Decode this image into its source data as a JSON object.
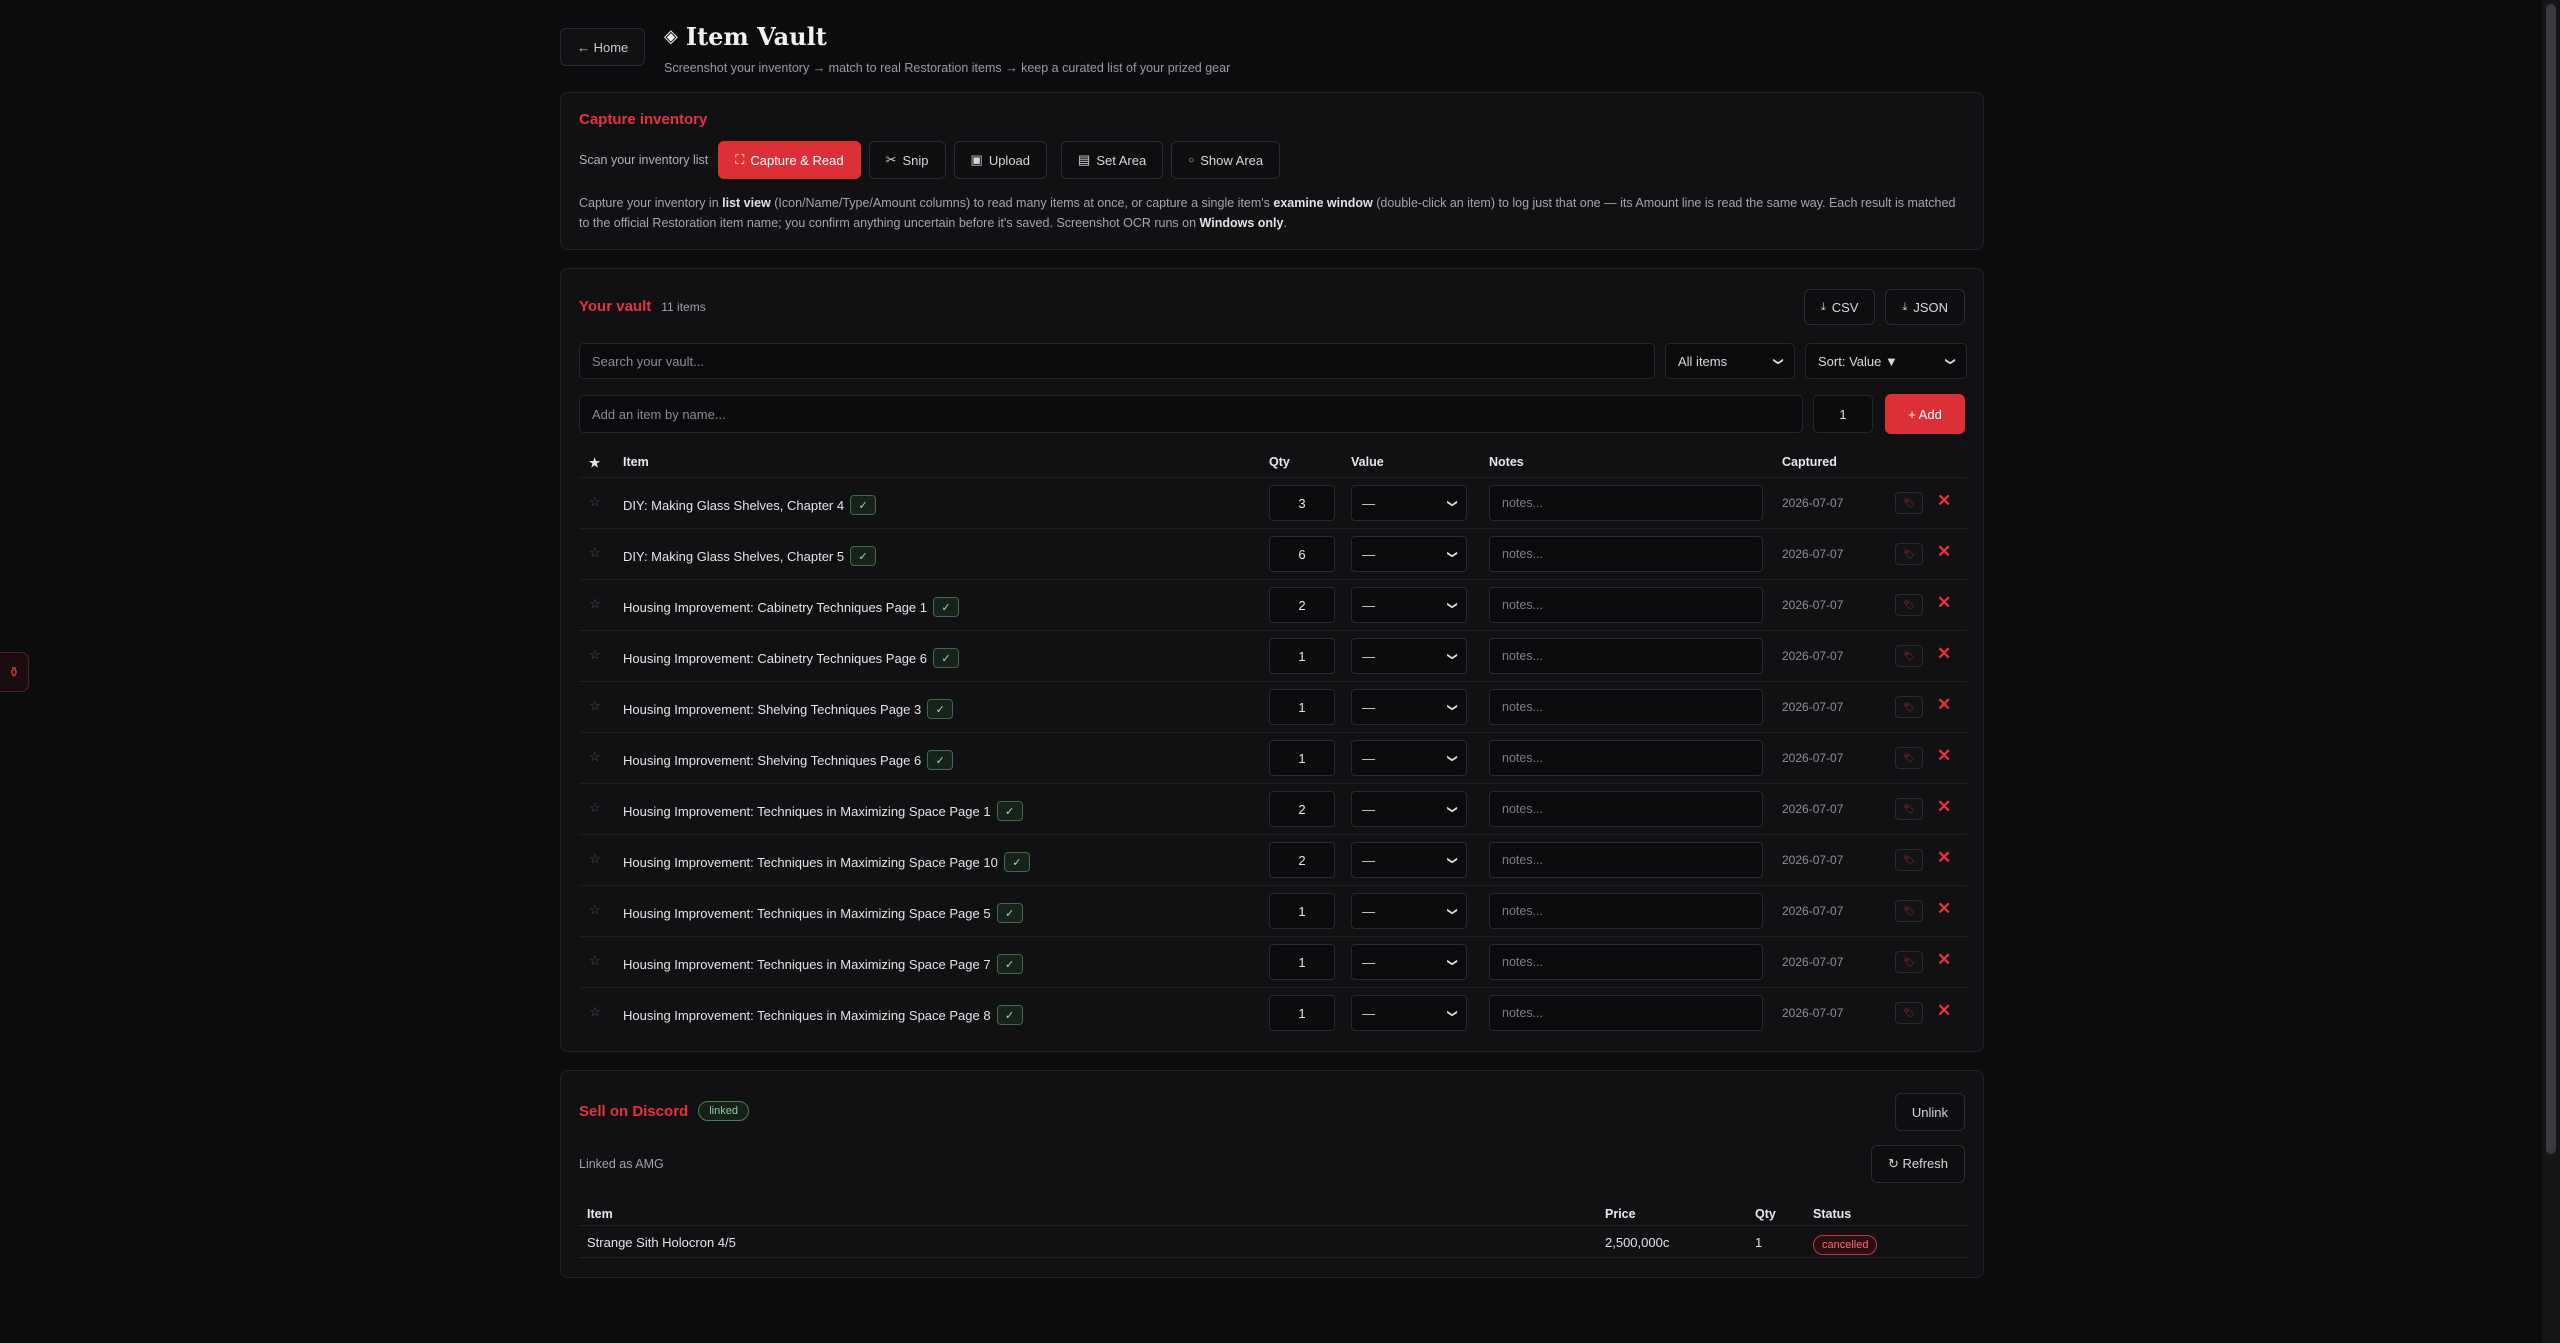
{
  "header": {
    "home_label": "← Home",
    "title": "Item Vault",
    "subtitle": "Screenshot your inventory → match to real Restoration items → keep a curated list of your prized gear"
  },
  "capture": {
    "title": "Capture inventory",
    "scan_label": "Scan your inventory list",
    "buttons": {
      "capture": "Capture & Read",
      "snip": "Snip",
      "upload": "Upload",
      "set_area": "Set Area",
      "show_area": "Show Area"
    },
    "desc": {
      "p1": "Capture your inventory in ",
      "b1": "list view",
      "p2": " (Icon/Name/Type/Amount columns) to read many items at once, or capture a single item's ",
      "b2": "examine window",
      "p3": " (double-click an item) to log just that one — its Amount line is read the same way. Each result is matched to the official Restoration item name; you confirm anything uncertain before it's saved. Screenshot OCR runs on ",
      "b3": "Windows only",
      "p4": "."
    }
  },
  "vault": {
    "title": "Your vault",
    "count": "11 items",
    "export_csv": "CSV",
    "export_json": "JSON",
    "search_placeholder": "Search your vault...",
    "filter_selected": "All items",
    "sort_selected": "Sort: Value ▼",
    "add_placeholder": "Add an item by name...",
    "add_qty": "1",
    "add_label": "+ Add",
    "columns": {
      "star": "★",
      "item": "Item",
      "qty": "Qty",
      "value": "Value",
      "notes": "Notes",
      "captured": "Captured"
    },
    "rows": [
      {
        "name": "DIY: Making Glass Shelves, Chapter 4",
        "qty": "3",
        "value": "—",
        "notes": "notes...",
        "captured": "2026-07-07"
      },
      {
        "name": "DIY: Making Glass Shelves, Chapter 5",
        "qty": "6",
        "value": "—",
        "notes": "notes...",
        "captured": "2026-07-07"
      },
      {
        "name": "Housing Improvement: Cabinetry Techniques Page 1",
        "qty": "2",
        "value": "—",
        "notes": "notes...",
        "captured": "2026-07-07"
      },
      {
        "name": "Housing Improvement: Cabinetry Techniques Page 6",
        "qty": "1",
        "value": "—",
        "notes": "notes...",
        "captured": "2026-07-07"
      },
      {
        "name": "Housing Improvement: Shelving Techniques Page 3",
        "qty": "1",
        "value": "—",
        "notes": "notes...",
        "captured": "2026-07-07"
      },
      {
        "name": "Housing Improvement: Shelving Techniques Page 6",
        "qty": "1",
        "value": "—",
        "notes": "notes...",
        "captured": "2026-07-07"
      },
      {
        "name": "Housing Improvement: Techniques in Maximizing Space Page 1",
        "qty": "2",
        "value": "—",
        "notes": "notes...",
        "captured": "2026-07-07"
      },
      {
        "name": "Housing Improvement: Techniques in Maximizing Space Page 10",
        "qty": "2",
        "value": "—",
        "notes": "notes...",
        "captured": "2026-07-07"
      },
      {
        "name": "Housing Improvement: Techniques in Maximizing Space Page 5",
        "qty": "1",
        "value": "—",
        "notes": "notes...",
        "captured": "2026-07-07"
      },
      {
        "name": "Housing Improvement: Techniques in Maximizing Space Page 7",
        "qty": "1",
        "value": "—",
        "notes": "notes...",
        "captured": "2026-07-07"
      },
      {
        "name": "Housing Improvement: Techniques in Maximizing Space Page 8",
        "qty": "1",
        "value": "—",
        "notes": "notes...",
        "captured": "2026-07-07"
      }
    ]
  },
  "discord": {
    "title": "Sell on Discord",
    "linked_badge": "linked",
    "unlink_label": "Unlink",
    "linked_as": "Linked as AMG",
    "refresh_label": "↻ Refresh",
    "columns": {
      "item": "Item",
      "price": "Price",
      "qty": "Qty",
      "status": "Status"
    },
    "listings": [
      {
        "item": "Strange Sith Holocron 4/5",
        "price": "2,500,000c",
        "qty": "1",
        "status": "cancelled"
      }
    ]
  },
  "colors": {
    "accent": "#e5323c",
    "background": "#0c0c0e",
    "card": "#111114",
    "linked": "#8ccc9e"
  },
  "icons": {
    "brand": "diamond-icon",
    "capture": "frame-corners-icon",
    "snip": "scissors-icon",
    "upload": "image-icon",
    "set_area": "floppy-icon",
    "show_area": "circle-icon",
    "download": "download-icon",
    "star": "star-icon",
    "check": "check-icon",
    "sell": "tag-icon",
    "delete": "close-icon",
    "side": "drop-icon"
  }
}
